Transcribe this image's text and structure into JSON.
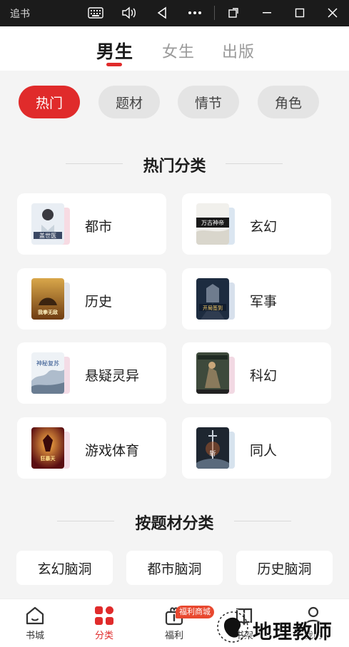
{
  "system_bar": {
    "title": "追书",
    "icons": [
      "keyboard-icon",
      "volume-icon",
      "back-triangle-icon",
      "more-dots-icon",
      "rotate-icon",
      "minimize-icon",
      "maximize-icon",
      "close-icon"
    ]
  },
  "top_tabs": [
    {
      "label": "男生",
      "active": true
    },
    {
      "label": "女生",
      "active": false
    },
    {
      "label": "出版",
      "active": false
    }
  ],
  "chips": [
    {
      "label": "热门",
      "active": true
    },
    {
      "label": "题材",
      "active": false
    },
    {
      "label": "情节",
      "active": false
    },
    {
      "label": "角色",
      "active": false
    }
  ],
  "hot_section": {
    "title": "热门分类",
    "items": [
      {
        "label": "都市",
        "cover_text": "盖世医"
      },
      {
        "label": "玄幻",
        "cover_text": "万古神帝"
      },
      {
        "label": "历史",
        "cover_text": "我拳无敌"
      },
      {
        "label": "军事",
        "cover_text": "开局签到"
      },
      {
        "label": "悬疑灵异",
        "cover_text": "神秘复苏"
      },
      {
        "label": "科幻",
        "cover_text": ""
      },
      {
        "label": "游戏体育",
        "cover_text": "狂暴天"
      },
      {
        "label": "同人",
        "cover_text": "斩"
      }
    ]
  },
  "theme_section": {
    "title": "按题材分类",
    "items": [
      "玄幻脑洞",
      "都市脑洞",
      "历史脑洞"
    ]
  },
  "bottom_nav": [
    {
      "label": "书城",
      "icon": "home-icon",
      "active": false
    },
    {
      "label": "分类",
      "icon": "category-grid-icon",
      "active": true
    },
    {
      "label": "福利",
      "icon": "gift-icon",
      "active": false
    },
    {
      "label": "书架",
      "icon": "bookshelf-icon",
      "active": false
    },
    {
      "label": "我的",
      "icon": "profile-icon",
      "active": false
    }
  ],
  "welfare_badge": "福利商城",
  "watermark": "地理教师",
  "colors": {
    "accent": "#e02b2b",
    "background": "#f4f4f4",
    "card": "#ffffff"
  }
}
